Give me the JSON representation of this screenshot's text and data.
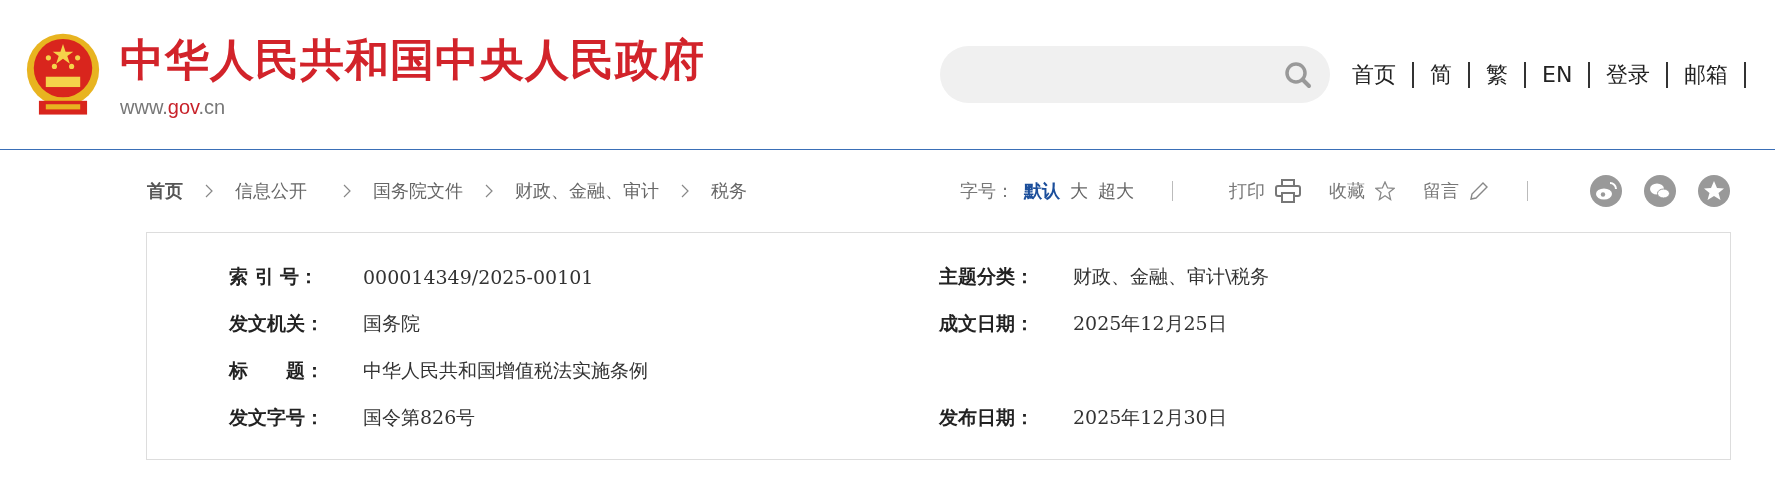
{
  "header": {
    "title": "中华人民共和国中央人民政府",
    "domain_prefix": "www.",
    "domain_main": "gov",
    "domain_suffix": ".cn"
  },
  "nav": [
    "首页",
    "简",
    "繁",
    "EN",
    "登录",
    "邮箱"
  ],
  "breadcrumb": [
    "首页",
    "信息公开",
    "国务院文件",
    "财政、金融、审计",
    "税务"
  ],
  "font_size": {
    "label": "字号：",
    "options": [
      {
        "label": "默认",
        "selected": true
      },
      {
        "label": "大",
        "selected": false
      },
      {
        "label": "超大",
        "selected": false
      }
    ]
  },
  "tools": [
    {
      "label": "打印",
      "kind": "print"
    },
    {
      "label": "收藏",
      "kind": "star"
    },
    {
      "label": "留言",
      "kind": "pencil"
    }
  ],
  "share": [
    {
      "kind": "weibo"
    },
    {
      "kind": "wechat"
    },
    {
      "kind": "qzone"
    }
  ],
  "info": [
    {
      "label": "索 引 号：",
      "value": "000014349/2025-00101",
      "label2": "主题分类：",
      "value2": "财政、金融、审计\\税务"
    },
    {
      "label": "发文机关：",
      "value": "国务院",
      "label2": "成文日期：",
      "value2": "2025年12月25日"
    },
    {
      "label": "标　　题：",
      "value": "中华人民共和国增值税法实施条例"
    },
    {
      "label": "发文字号：",
      "value": "国令第826号",
      "label2": "发布日期：",
      "value2": "2025年12月30日"
    }
  ]
}
